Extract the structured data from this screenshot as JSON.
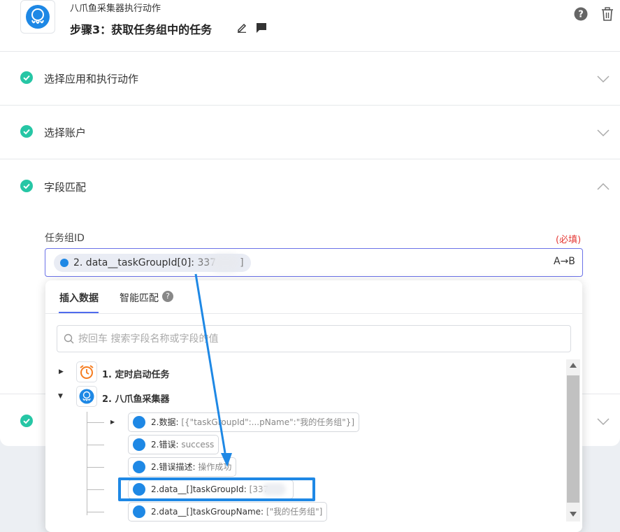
{
  "header": {
    "app_name": "八爪鱼采集器执行动作",
    "step_title": "步骤3：获取任务组中的任务"
  },
  "sections": [
    {
      "title": "选择应用和执行动作"
    },
    {
      "title": "选择账户"
    },
    {
      "title": "字段匹配"
    }
  ],
  "field": {
    "label": "任务组ID",
    "required": "(必填)",
    "chip_name": "2. data__taskGroupId[0]:",
    "chip_value": " 337",
    "chip_tail": "]",
    "transform": "A→B"
  },
  "dropdown": {
    "tabs": [
      {
        "label": "插入数据",
        "active": true
      },
      {
        "label": "智能匹配",
        "active": false
      }
    ],
    "tab_help": "?",
    "search_placeholder": "按回车 搜索字段名称或字段的值",
    "nodes": [
      {
        "label": "1. 定时启动任务",
        "icon": "alarm-clock-icon",
        "expanded": false
      },
      {
        "label": "2. 八爪鱼采集器",
        "icon": "octopus-logo-icon",
        "expanded": true
      }
    ],
    "items": [
      {
        "name": "2.数据:",
        "value": " [{\"taskGroupId\":...pName\":\"我的任务组\"}]",
        "expandable": true
      },
      {
        "name": "2.错误:",
        "value": " success",
        "expandable": false
      },
      {
        "name": "2.错误描述:",
        "value": " 操作成功",
        "expandable": false
      },
      {
        "name": "2.data__[]taskGroupId:",
        "value": " [337",
        "expandable": false,
        "highlighted": true
      },
      {
        "name": "2.data__[]taskGroupName:",
        "value": " [\"我的任务组\"]",
        "expandable": false
      }
    ]
  },
  "colors": {
    "accent": "#4f6bed",
    "success": "#26c6a5",
    "annotation": "#1e88e5",
    "required": "#e53935"
  }
}
